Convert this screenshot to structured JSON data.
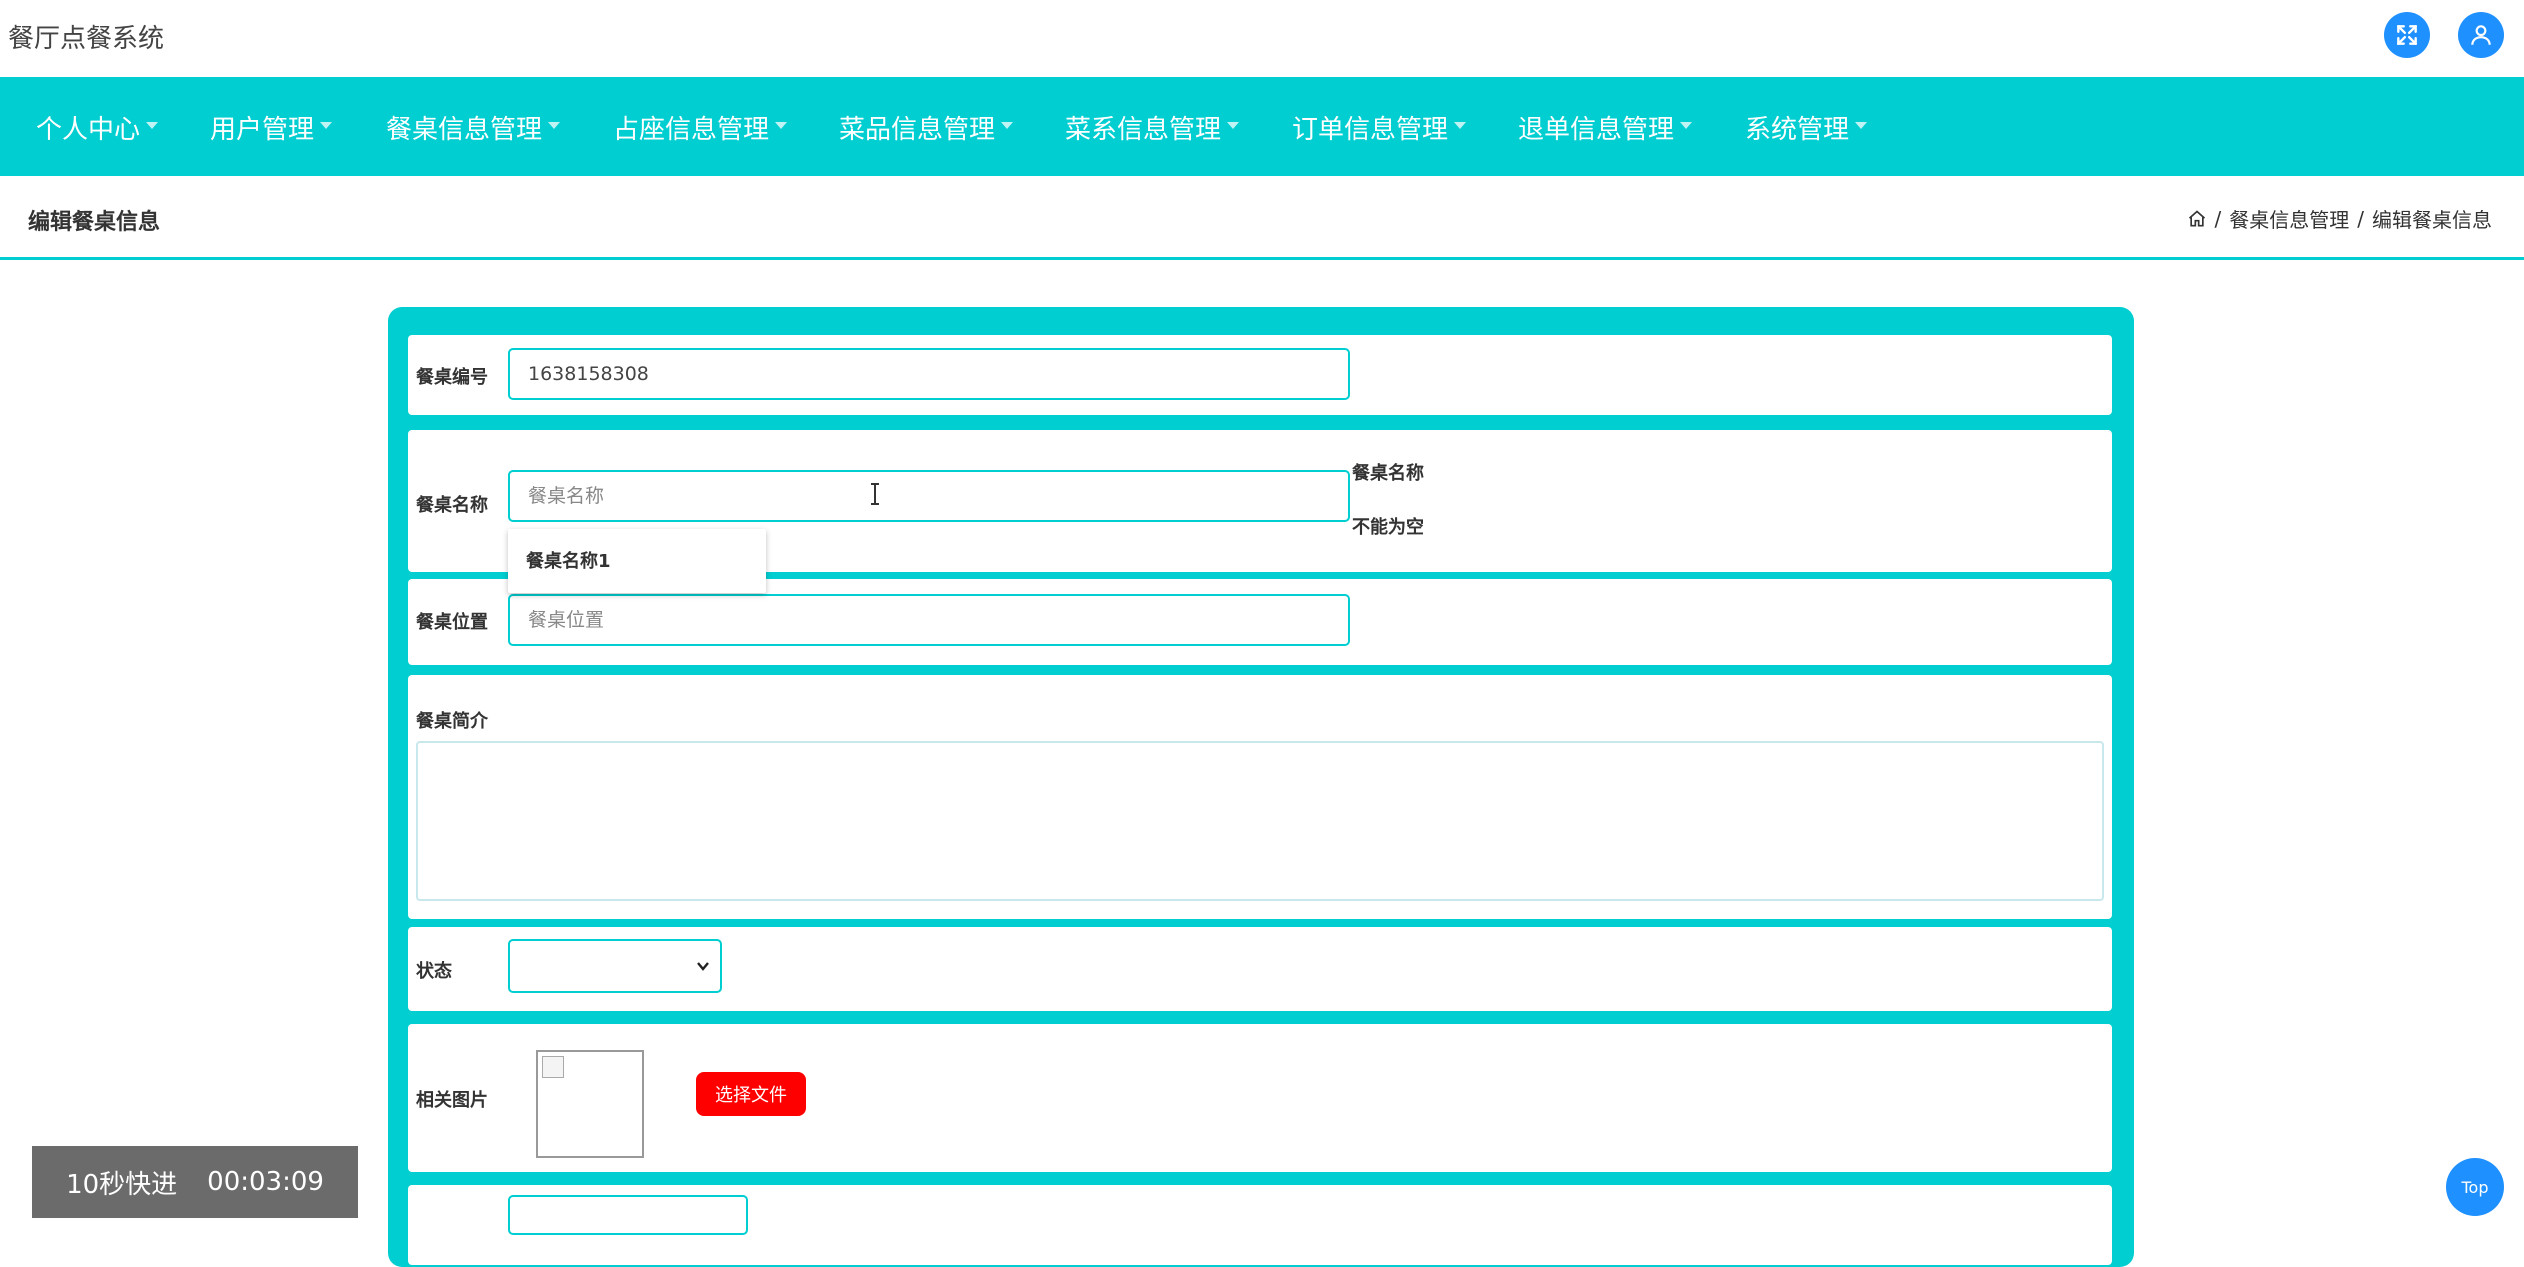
{
  "app": {
    "title": "餐厅点餐系统"
  },
  "nav": {
    "items": [
      {
        "label": "个人中心"
      },
      {
        "label": "用户管理"
      },
      {
        "label": "餐桌信息管理"
      },
      {
        "label": "占座信息管理"
      },
      {
        "label": "菜品信息管理"
      },
      {
        "label": "菜系信息管理"
      },
      {
        "label": "订单信息管理"
      },
      {
        "label": "退单信息管理"
      },
      {
        "label": "系统管理"
      }
    ]
  },
  "page": {
    "heading": "编辑餐桌信息",
    "breadcrumb": {
      "sep1": "/",
      "level1": "餐桌信息管理",
      "sep2": "/",
      "level2": "编辑餐桌信息"
    }
  },
  "form": {
    "table_no": {
      "label": "餐桌编号",
      "value": "1638158308"
    },
    "table_name": {
      "label": "餐桌名称",
      "placeholder": "餐桌名称",
      "error_line1": "餐桌名称",
      "error_line2": "不能为空",
      "suggestion": "餐桌名称1"
    },
    "table_location": {
      "label": "餐桌位置",
      "placeholder": "餐桌位置"
    },
    "table_intro": {
      "label": "餐桌简介"
    },
    "status": {
      "label": "状态",
      "value": ""
    },
    "image": {
      "label": "相关图片",
      "button": "选择文件"
    }
  },
  "video": {
    "skip_label": "10秒快进",
    "time": "00:03:09"
  },
  "back_to_top": "Top",
  "colors": {
    "primary": "#00ced1",
    "accent": "#1e90ff",
    "danger": "#ff0000"
  }
}
